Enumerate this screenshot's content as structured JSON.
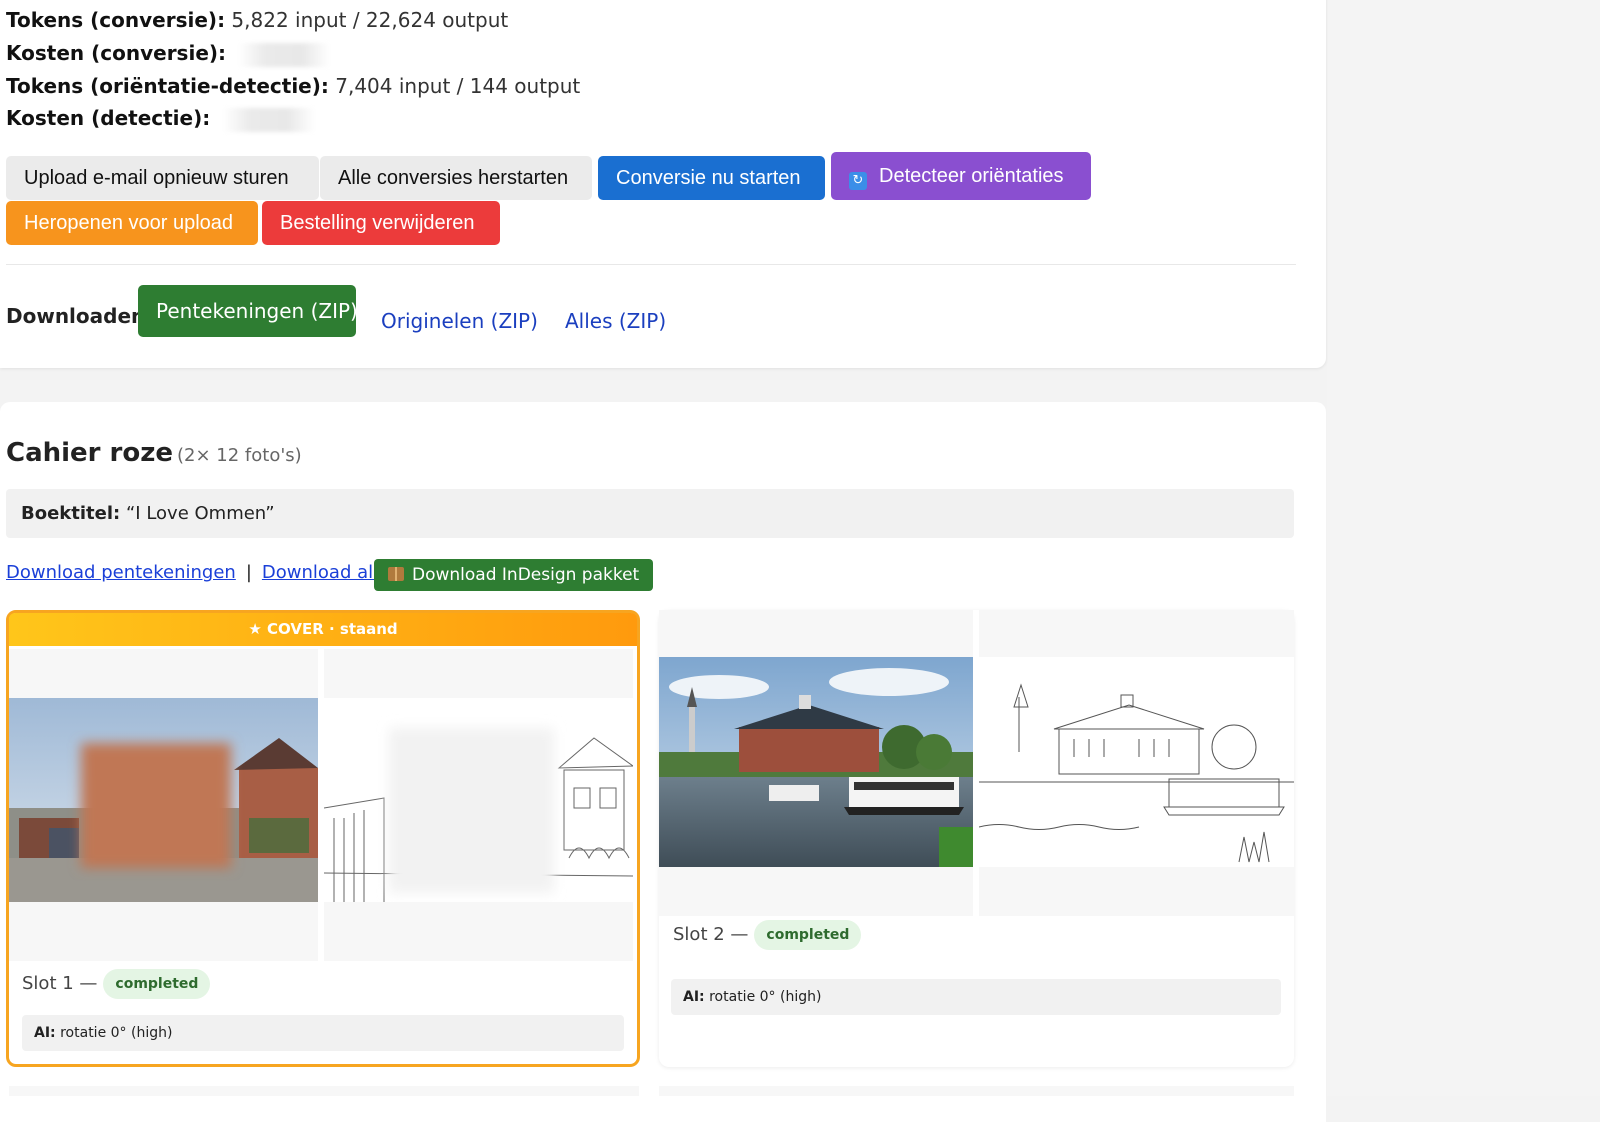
{
  "stats": {
    "tokens_conv_label": "Tokens (conversie):",
    "tokens_conv_value": "5,822 input / 22,624 output",
    "cost_conv_label": "Kosten (conversie):",
    "tokens_det_label": "Tokens (oriëntatie-detectie):",
    "tokens_det_value": "7,404 input / 144 output",
    "cost_det_label": "Kosten (detectie):"
  },
  "actions": {
    "resend": "Upload e-mail opnieuw sturen",
    "restart": "Alle conversies herstarten",
    "start": "Conversie nu starten",
    "detect": "Detecteer oriëntaties",
    "reopen": "Heropenen voor upload",
    "delete": "Bestelling verwijderen"
  },
  "downloads": {
    "label": "Downloaden:",
    "drawings": "Pentekeningen (ZIP)",
    "originals": "Originelen (ZIP)",
    "all": "Alles (ZIP)"
  },
  "section": {
    "title": "Cahier roze",
    "subtitle": "(2× 12 foto's)",
    "booktitle_label": "Boektitel:",
    "booktitle_value": "“I Love Ommen”",
    "link_drawings": "Download pentekeningen",
    "link_all": "Download alles",
    "sep": "|",
    "indesign": "Download InDesign pakket"
  },
  "slots": [
    {
      "banner": "★ COVER · staand",
      "label": "Slot 1 —",
      "status": "completed",
      "ai_label": "AI:",
      "ai_value": "rotatie 0° (high)"
    },
    {
      "label": "Slot 2 —",
      "status": "completed",
      "ai_label": "AI:",
      "ai_value": "rotatie 0° (high)"
    }
  ],
  "colors": {
    "blue": "#1a6fd1",
    "purple": "#8a4fd0",
    "orange": "#f7941d",
    "red": "#ec3b3b",
    "green": "#2e7d32",
    "cover_border": "#f7a520"
  },
  "icons": {
    "detect": "refresh-icon",
    "indesign": "package-icon"
  }
}
